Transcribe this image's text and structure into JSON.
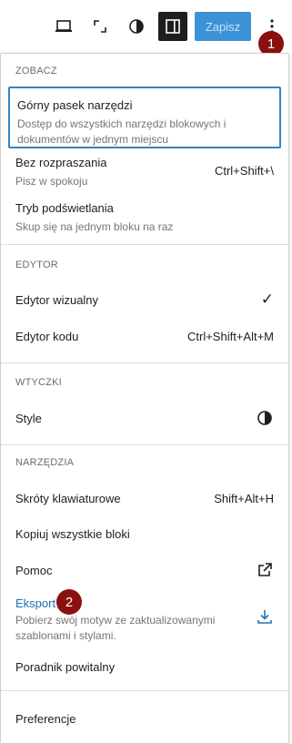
{
  "toolbar": {
    "save_label": "Zapisz",
    "badge1": "1"
  },
  "menu": {
    "view": {
      "title": "ZOBACZ",
      "items": [
        {
          "label": "Górny pasek narzędzi",
          "desc": "Dostęp do wszystkich narzędzi blokowych i dokumentów w jednym miejscu"
        },
        {
          "label": "Bez rozpraszania",
          "desc": "Pisz w spokoju",
          "shortcut": "Ctrl+Shift+\\"
        },
        {
          "label": "Tryb podświetlania",
          "desc": "Skup się na jednym bloku na raz"
        }
      ]
    },
    "editor": {
      "title": "EDYTOR",
      "items": [
        {
          "label": "Edytor wizualny",
          "check": "✓"
        },
        {
          "label": "Edytor kodu",
          "shortcut": "Ctrl+Shift+Alt+M"
        }
      ]
    },
    "plugins": {
      "title": "WTYCZKI",
      "items": [
        {
          "label": "Style"
        }
      ]
    },
    "tools": {
      "title": "NARZĘDZIA",
      "items": [
        {
          "label": "Skróty klawiaturowe",
          "shortcut": "Shift+Alt+H"
        },
        {
          "label": "Kopiuj wszystkie bloki"
        },
        {
          "label": "Pomoc"
        },
        {
          "label": "Eksport",
          "desc": "Pobierz swój motyw ze zaktualizowanymi szablonami i stylami.",
          "badge": "2"
        },
        {
          "label": "Poradnik powitalny"
        }
      ]
    },
    "prefs": {
      "items": [
        {
          "label": "Preferencje"
        }
      ]
    }
  },
  "colors": {
    "accent": "#3582c4",
    "save_bg": "#3b92d6",
    "badge": "#8b1010"
  },
  "icons": [
    "laptop-icon",
    "fullscreen-icon",
    "contrast-icon",
    "sidebar-icon",
    "more-vertical-icon",
    "check-icon",
    "external-link-icon",
    "download-icon"
  ]
}
